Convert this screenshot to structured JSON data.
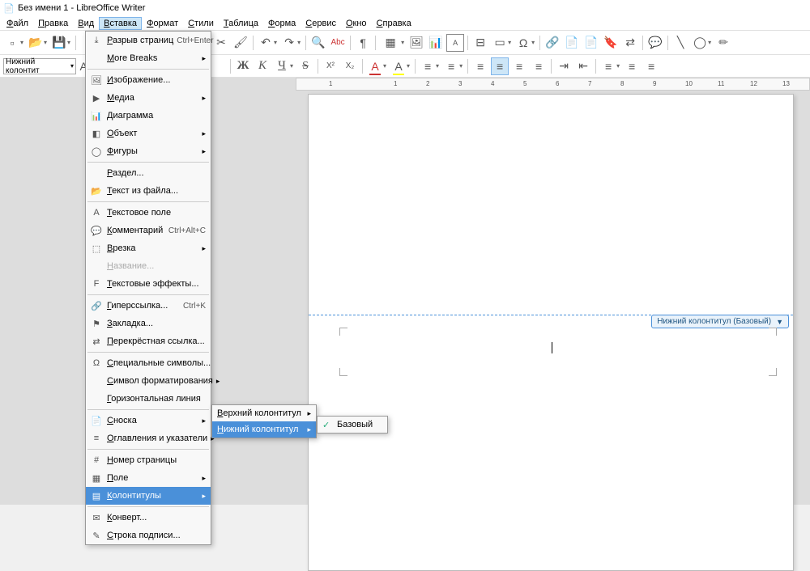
{
  "title": "Без имени 1 - LibreOffice Writer",
  "menubar": [
    "Файл",
    "Правка",
    "Вид",
    "Вставка",
    "Формат",
    "Стили",
    "Таблица",
    "Форма",
    "Сервис",
    "Окно",
    "Справка"
  ],
  "active_menu_index": 3,
  "style_combo": "Нижний колонтит",
  "insert_menu": [
    {
      "icon": "⤓",
      "label": "Разрыв страниц",
      "shortcut": "Ctrl+Enter",
      "submenu": false,
      "type": "item"
    },
    {
      "icon": "",
      "label": "More Breaks",
      "submenu": true,
      "type": "item"
    },
    {
      "type": "sep"
    },
    {
      "icon": "🖼",
      "label": "Изображение...",
      "type": "item"
    },
    {
      "icon": "▶",
      "label": "Медиа",
      "submenu": true,
      "type": "item"
    },
    {
      "icon": "📊",
      "label": "Диаграмма",
      "type": "item"
    },
    {
      "icon": "◧",
      "label": "Объект",
      "submenu": true,
      "type": "item"
    },
    {
      "icon": "◯",
      "label": "Фигуры",
      "submenu": true,
      "type": "item"
    },
    {
      "type": "sep"
    },
    {
      "icon": "",
      "label": "Раздел...",
      "type": "item"
    },
    {
      "icon": "📂",
      "label": "Текст из файла...",
      "type": "item"
    },
    {
      "type": "sep"
    },
    {
      "icon": "A",
      "label": "Текстовое поле",
      "type": "item"
    },
    {
      "icon": "💬",
      "label": "Комментарий",
      "shortcut": "Ctrl+Alt+C",
      "type": "item"
    },
    {
      "icon": "⬚",
      "label": "Врезка",
      "submenu": true,
      "type": "item"
    },
    {
      "icon": "",
      "label": "Название...",
      "disabled": true,
      "type": "item"
    },
    {
      "icon": "F",
      "label": "Текстовые эффекты...",
      "type": "item"
    },
    {
      "type": "sep"
    },
    {
      "icon": "🔗",
      "label": "Гиперссылка...",
      "shortcut": "Ctrl+K",
      "type": "item"
    },
    {
      "icon": "⚑",
      "label": "Закладка...",
      "type": "item"
    },
    {
      "icon": "⇄",
      "label": "Перекрёстная ссылка...",
      "type": "item"
    },
    {
      "type": "sep"
    },
    {
      "icon": "Ω",
      "label": "Специальные символы...",
      "type": "item"
    },
    {
      "icon": "",
      "label": "Символ форматирования",
      "submenu": true,
      "type": "item"
    },
    {
      "icon": "",
      "label": "Горизонтальная линия",
      "type": "item"
    },
    {
      "type": "sep"
    },
    {
      "icon": "📄",
      "label": "Сноска",
      "submenu": true,
      "type": "item"
    },
    {
      "icon": "≡",
      "label": "Оглавления и указатели",
      "submenu": true,
      "type": "item"
    },
    {
      "type": "sep"
    },
    {
      "icon": "#",
      "label": "Номер страницы",
      "type": "item"
    },
    {
      "icon": "▦",
      "label": "Поле",
      "submenu": true,
      "type": "item"
    },
    {
      "icon": "▤",
      "label": "Колонтитулы",
      "submenu": true,
      "highlighted": true,
      "type": "item"
    },
    {
      "type": "sep"
    },
    {
      "icon": "✉",
      "label": "Конверт...",
      "type": "item"
    },
    {
      "icon": "✎",
      "label": "Строка подписи...",
      "type": "item"
    }
  ],
  "submenu1": [
    {
      "label": "Верхний колонтитул",
      "submenu": true
    },
    {
      "label": "Нижний колонтитул",
      "submenu": true,
      "highlighted": true
    }
  ],
  "submenu2": [
    {
      "label": "Базовый",
      "checked": true
    }
  ],
  "footer_label": "Нижний колонтитул (Базовый)",
  "ruler_marks": [
    {
      "pos": 0,
      "label": ""
    },
    {
      "pos": 40,
      "label": "1"
    },
    {
      "pos": 80,
      "label": ""
    },
    {
      "pos": 120,
      "label": "1"
    },
    {
      "pos": 160,
      "label": "2"
    },
    {
      "pos": 200,
      "label": "3"
    },
    {
      "pos": 240,
      "label": "4"
    },
    {
      "pos": 280,
      "label": "5"
    },
    {
      "pos": 320,
      "label": "6"
    },
    {
      "pos": 360,
      "label": "7"
    },
    {
      "pos": 400,
      "label": "8"
    },
    {
      "pos": 440,
      "label": "9"
    },
    {
      "pos": 480,
      "label": "10"
    },
    {
      "pos": 520,
      "label": "11"
    },
    {
      "pos": 560,
      "label": "12"
    },
    {
      "pos": 600,
      "label": "13"
    }
  ]
}
